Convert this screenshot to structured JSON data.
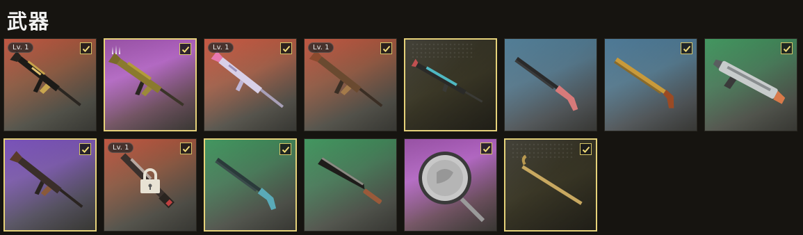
{
  "header": {
    "title": "武器"
  },
  "cards": [
    {
      "name": "weapon-card-rifle-black-gold",
      "level_badge": "Lv. 1",
      "checked": true,
      "selected": false,
      "locked": false,
      "rank_icon": false,
      "bg": "linear-gradient(160deg,#b8452e 0%,#8a5a42 40%,#5b5b52 75%,#4a4a44 100%)",
      "weapon": "ak-rifle"
    },
    {
      "name": "weapon-card-rifle-gold-purple",
      "level_badge": "",
      "checked": true,
      "selected": true,
      "locked": false,
      "rank_icon": true,
      "bg": "linear-gradient(160deg,#8c3f9a 0%,#b268c2 35%,#7a5a6a 70%,#4d4a45 100%)",
      "weapon": "ak-rifle-gold"
    },
    {
      "name": "weapon-card-rifle-white-pink",
      "level_badge": "Lv. 1",
      "checked": true,
      "selected": false,
      "locked": false,
      "rank_icon": false,
      "bg": "linear-gradient(160deg,#c0472f 0%,#a0604a 40%,#5f5d55 75%,#4a4a44 100%)",
      "weapon": "white-rifle"
    },
    {
      "name": "weapon-card-rifle-bronze",
      "level_badge": "Lv. 1",
      "checked": true,
      "selected": false,
      "locked": false,
      "rank_icon": false,
      "bg": "linear-gradient(160deg,#b8452e 0%,#8f5a44 40%,#5b5a52 75%,#4a4a44 100%)",
      "weapon": "bronze-rifle"
    },
    {
      "name": "weapon-card-rifle-teal-red",
      "level_badge": "",
      "checked": false,
      "selected": true,
      "locked": false,
      "rank_icon": false,
      "bg": "linear-gradient(160deg,#2e2c22 0%,#3a3726 50%,#2a281f 100%)",
      "weapon": "teal-rifle"
    },
    {
      "name": "weapon-card-shotgun-pink",
      "level_badge": "",
      "checked": false,
      "selected": false,
      "locked": false,
      "rank_icon": false,
      "bg": "linear-gradient(160deg,#3f6f8a 0%,#56778a 40%,#5a5f62 75%,#4a4a46 100%)",
      "weapon": "pink-shotgun"
    },
    {
      "name": "weapon-card-shotgun-gold",
      "level_badge": "",
      "checked": true,
      "selected": false,
      "locked": false,
      "rank_icon": false,
      "bg": "linear-gradient(160deg,#3a6a8a 0%,#55788c 40%,#5a5f62 75%,#4a4a46 100%)",
      "weapon": "gold-shotgun"
    },
    {
      "name": "weapon-card-shotgun-silver",
      "level_badge": "",
      "checked": true,
      "selected": false,
      "locked": false,
      "rank_icon": false,
      "bg": "linear-gradient(160deg,#2e8a4e 0%,#4a7a5a 40%,#5a5d55 75%,#4a4a44 100%)",
      "weapon": "silver-shotgun"
    },
    {
      "name": "weapon-card-rifle-dark-bronze",
      "level_badge": "",
      "checked": true,
      "selected": true,
      "locked": false,
      "rank_icon": false,
      "bg": "linear-gradient(160deg,#6a3fb0 0%,#7a5aa8 35%,#5e5a6a 70%,#4a4a44 100%)",
      "weapon": "dark-rifle"
    },
    {
      "name": "weapon-card-rifle-locked",
      "level_badge": "Lv. 1",
      "checked": true,
      "selected": false,
      "locked": true,
      "rank_icon": false,
      "bg": "linear-gradient(160deg,#b8452e 0%,#8a5a44 40%,#5b5a52 75%,#4a4a44 100%)",
      "weapon": "red-rifle"
    },
    {
      "name": "weapon-card-shotgun-teal",
      "level_badge": "",
      "checked": true,
      "selected": true,
      "locked": false,
      "rank_icon": false,
      "bg": "linear-gradient(160deg,#2e8a4e 0%,#4a7a5a 40%,#5a5d55 75%,#4a4a44 100%)",
      "weapon": "teal-shotgun"
    },
    {
      "name": "weapon-card-machete",
      "level_badge": "",
      "checked": false,
      "selected": false,
      "locked": false,
      "rank_icon": false,
      "bg": "linear-gradient(160deg,#2e8a4e 0%,#4a7a5a 40%,#5a5d55 75%,#4a4a44 100%)",
      "weapon": "machete"
    },
    {
      "name": "weapon-card-frying-pan",
      "level_badge": "",
      "checked": true,
      "selected": false,
      "locked": false,
      "rank_icon": false,
      "bg": "linear-gradient(160deg,#8c3f9a 0%,#b268c2 35%,#7a5a6a 70%,#4d4a45 100%)",
      "weapon": "pan"
    },
    {
      "name": "weapon-card-crowbar-gold",
      "level_badge": "",
      "checked": true,
      "selected": true,
      "locked": false,
      "rank_icon": false,
      "bg": "linear-gradient(160deg,#2e2c22 0%,#3a3726 50%,#2a281f 100%)",
      "weapon": "crowbar"
    }
  ]
}
